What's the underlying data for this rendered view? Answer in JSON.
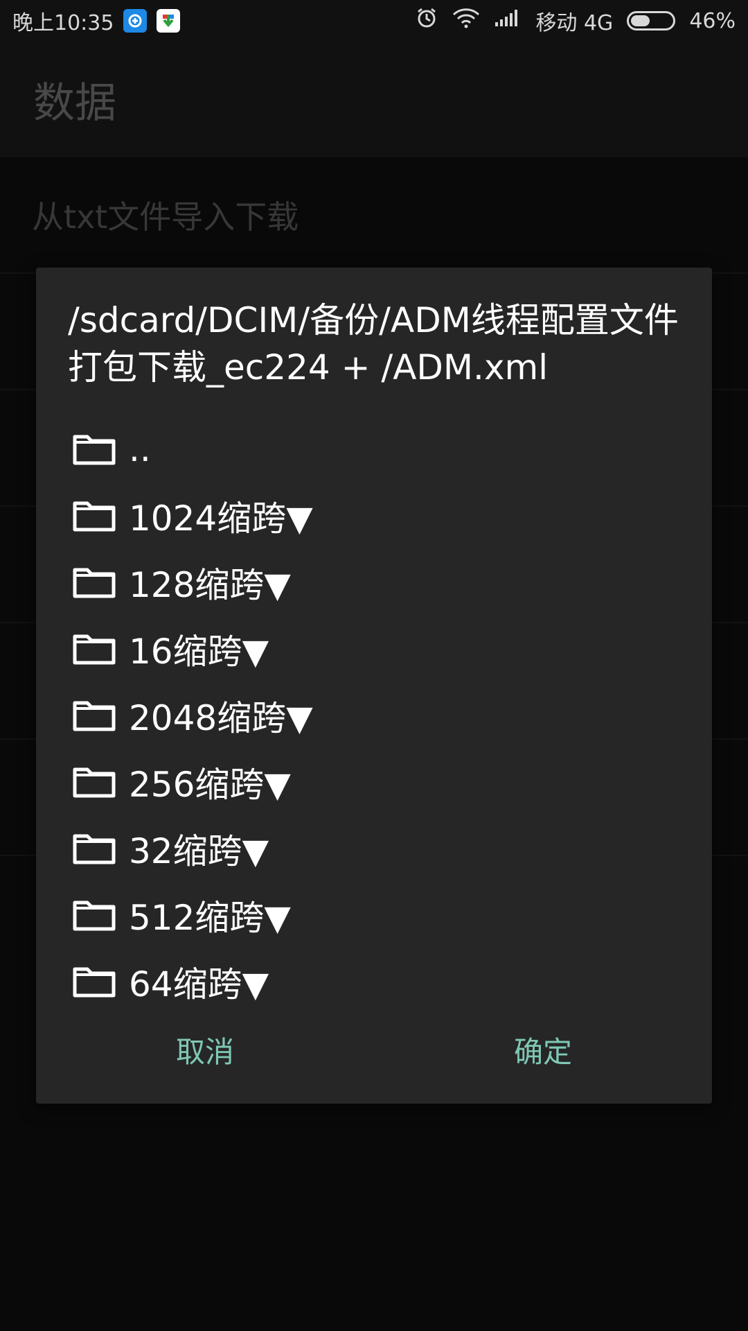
{
  "status_bar": {
    "time": "晚上10:35",
    "carrier": "移动 4G",
    "battery_percent": "46%",
    "battery_level": 0.46,
    "icons": [
      "notification-app-icon",
      "download-app-icon",
      "alarm-icon",
      "wifi-icon",
      "signal-icon",
      "battery-icon"
    ]
  },
  "appbar": {
    "title": "数据"
  },
  "background_list": {
    "items": [
      {
        "label": "从txt文件导入下载"
      },
      {
        "label": ""
      },
      {
        "label": ""
      },
      {
        "label": ""
      },
      {
        "label": ""
      },
      {
        "label": ""
      }
    ]
  },
  "dialog": {
    "title": "/sdcard/DCIM/备份/ADM线程配置文件打包下载_ec224 + /ADM.xml",
    "entries": [
      {
        "name": ".."
      },
      {
        "name": "1024缩跨▼"
      },
      {
        "name": "128缩跨▼"
      },
      {
        "name": "16缩跨▼"
      },
      {
        "name": "2048缩跨▼"
      },
      {
        "name": "256缩跨▼"
      },
      {
        "name": "32缩跨▼"
      },
      {
        "name": "512缩跨▼"
      },
      {
        "name": "64缩跨▼"
      }
    ],
    "cancel_label": "取消",
    "ok_label": "确定",
    "accent_color": "#7fc8b5"
  }
}
